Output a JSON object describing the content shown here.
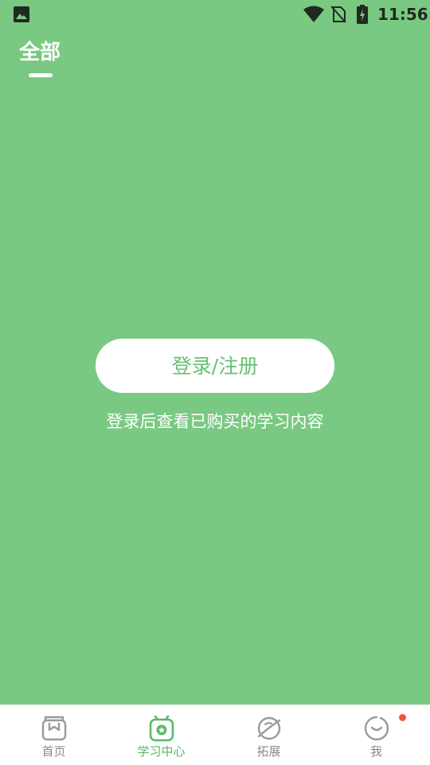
{
  "status_bar": {
    "time": "11:56",
    "icons": [
      "gallery-icon",
      "wifi-icon",
      "no-sim-icon",
      "battery-charging-icon"
    ]
  },
  "top_tabs": {
    "active_label": "全部"
  },
  "main": {
    "login_button_label": "登录/注册",
    "hint": "登录后查看已购买的学习内容"
  },
  "bottom_nav": {
    "items": [
      {
        "label": "首页",
        "icon": "home-icon",
        "active": false
      },
      {
        "label": "学习中心",
        "icon": "learning-center-icon",
        "active": true
      },
      {
        "label": "拓展",
        "icon": "explore-icon",
        "active": false
      },
      {
        "label": "我",
        "icon": "profile-icon",
        "active": false,
        "badge": true
      }
    ]
  },
  "colors": {
    "background": "#7ac982",
    "accent": "#5cb865",
    "badge": "#f25540",
    "inactive": "#8a8a8a"
  }
}
